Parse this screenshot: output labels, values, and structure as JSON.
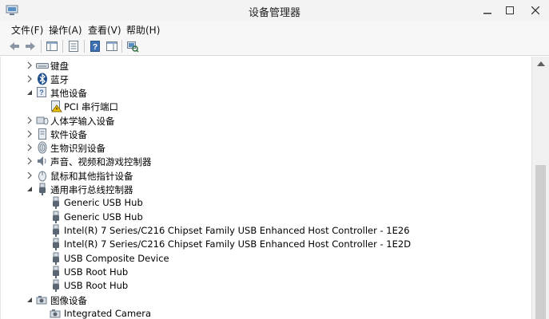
{
  "window": {
    "title": "设备管理器"
  },
  "menu": {
    "file": "文件(F)",
    "action": "操作(A)",
    "view": "查看(V)",
    "help": "帮助(H)"
  },
  "tree": {
    "keyboard": "键盘",
    "bluetooth": "蓝牙",
    "other_devices": "其他设备",
    "pci_serial": "PCI 串行端口",
    "hid": "人体学输入设备",
    "software_devices": "软件设备",
    "biometric": "生物识别设备",
    "sound": "声音、视频和游戏控制器",
    "mice": "鼠标和其他指针设备",
    "usb_controllers": "通用串行总线控制器",
    "usb_children": [
      "Generic USB Hub",
      "Generic USB Hub",
      "Intel(R) 7 Series/C216 Chipset Family USB Enhanced Host Controller - 1E26",
      "Intel(R) 7 Series/C216 Chipset Family USB Enhanced Host Controller - 1E2D",
      "USB Composite Device",
      "USB Root Hub",
      "USB Root Hub"
    ],
    "imaging": "图像设备",
    "integrated_camera": "Integrated Camera"
  }
}
